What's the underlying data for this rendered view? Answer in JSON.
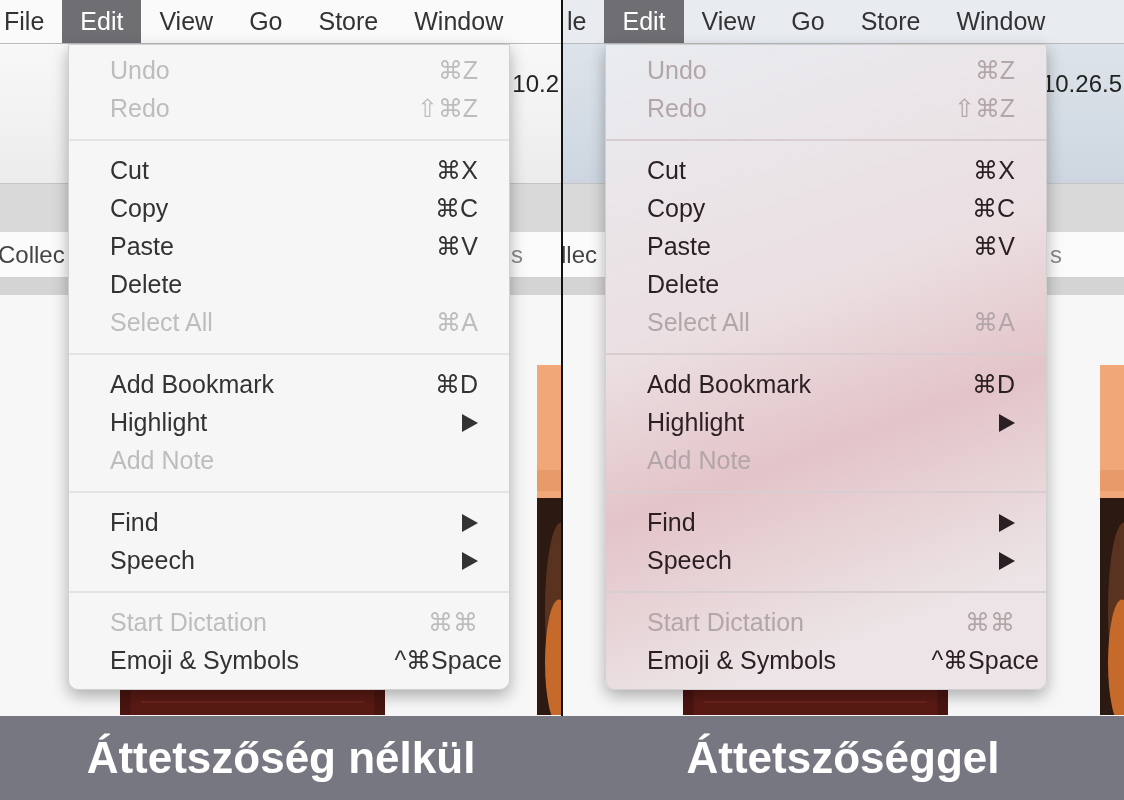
{
  "panels": [
    {
      "translucent": false,
      "menubar": [
        {
          "label": "File",
          "selected": false
        },
        {
          "label": "Edit",
          "selected": true
        },
        {
          "label": "View",
          "selected": false
        },
        {
          "label": "Go",
          "selected": false
        },
        {
          "label": "Store",
          "selected": false
        },
        {
          "label": "Window",
          "selected": false
        }
      ],
      "toolbar_text": "10.2",
      "tab_row_left": "Collec",
      "tab_row_right": "s",
      "menu": {
        "sections": [
          {
            "items": [
              {
                "kind": "item",
                "label": "Undo",
                "shortcut": "⌘Z",
                "disabled": true
              },
              {
                "kind": "item",
                "label": "Redo",
                "shortcut": "⇧⌘Z",
                "disabled": true
              }
            ]
          },
          {
            "items": [
              {
                "kind": "item",
                "label": "Cut",
                "shortcut": "⌘X",
                "disabled": false
              },
              {
                "kind": "item",
                "label": "Copy",
                "shortcut": "⌘C",
                "disabled": false
              },
              {
                "kind": "item",
                "label": "Paste",
                "shortcut": "⌘V",
                "disabled": false
              },
              {
                "kind": "item",
                "label": "Delete",
                "disabled": false
              },
              {
                "kind": "item",
                "label": "Select All",
                "shortcut": "⌘A",
                "disabled": true
              }
            ]
          },
          {
            "items": [
              {
                "kind": "item",
                "label": "Add Bookmark",
                "shortcut": "⌘D",
                "disabled": false
              },
              {
                "kind": "submenu",
                "label": "Highlight",
                "disabled": false
              },
              {
                "kind": "item",
                "label": "Add Note",
                "disabled": true
              }
            ]
          },
          {
            "items": [
              {
                "kind": "submenu",
                "label": "Find",
                "disabled": false
              },
              {
                "kind": "submenu",
                "label": "Speech",
                "disabled": false
              }
            ]
          },
          {
            "items": [
              {
                "kind": "item",
                "label": "Start Dictation",
                "shortcut": "⌘⌘",
                "disabled": true
              },
              {
                "kind": "item",
                "label": "Emoji & Symbols",
                "shortcut": "^⌘Space",
                "disabled": false
              }
            ]
          }
        ]
      },
      "caption": "Áttetszőség nélkül"
    },
    {
      "translucent": true,
      "menubar": [
        {
          "label": "le",
          "selected": false
        },
        {
          "label": "Edit",
          "selected": true
        },
        {
          "label": "View",
          "selected": false
        },
        {
          "label": "Go",
          "selected": false
        },
        {
          "label": "Store",
          "selected": false
        },
        {
          "label": "Window",
          "selected": false
        }
      ],
      "toolbar_text": "10.26.5",
      "tab_row_left": "llec",
      "tab_row_right": "s",
      "menu": {
        "sections": [
          {
            "items": [
              {
                "kind": "item",
                "label": "Undo",
                "shortcut": "⌘Z",
                "disabled": true
              },
              {
                "kind": "item",
                "label": "Redo",
                "shortcut": "⇧⌘Z",
                "disabled": true
              }
            ]
          },
          {
            "items": [
              {
                "kind": "item",
                "label": "Cut",
                "shortcut": "⌘X",
                "disabled": false
              },
              {
                "kind": "item",
                "label": "Copy",
                "shortcut": "⌘C",
                "disabled": false
              },
              {
                "kind": "item",
                "label": "Paste",
                "shortcut": "⌘V",
                "disabled": false
              },
              {
                "kind": "item",
                "label": "Delete",
                "disabled": false
              },
              {
                "kind": "item",
                "label": "Select All",
                "shortcut": "⌘A",
                "disabled": true
              }
            ]
          },
          {
            "items": [
              {
                "kind": "item",
                "label": "Add Bookmark",
                "shortcut": "⌘D",
                "disabled": false
              },
              {
                "kind": "submenu",
                "label": "Highlight",
                "disabled": false
              },
              {
                "kind": "item",
                "label": "Add Note",
                "disabled": true
              }
            ]
          },
          {
            "items": [
              {
                "kind": "submenu",
                "label": "Find",
                "disabled": false
              },
              {
                "kind": "submenu",
                "label": "Speech",
                "disabled": false
              }
            ]
          },
          {
            "items": [
              {
                "kind": "item",
                "label": "Start Dictation",
                "shortcut": "⌘⌘",
                "disabled": true
              },
              {
                "kind": "item",
                "label": "Emoji & Symbols",
                "shortcut": "^⌘Space",
                "disabled": false
              }
            ]
          }
        ]
      },
      "caption": "Áttetszőséggel"
    }
  ]
}
